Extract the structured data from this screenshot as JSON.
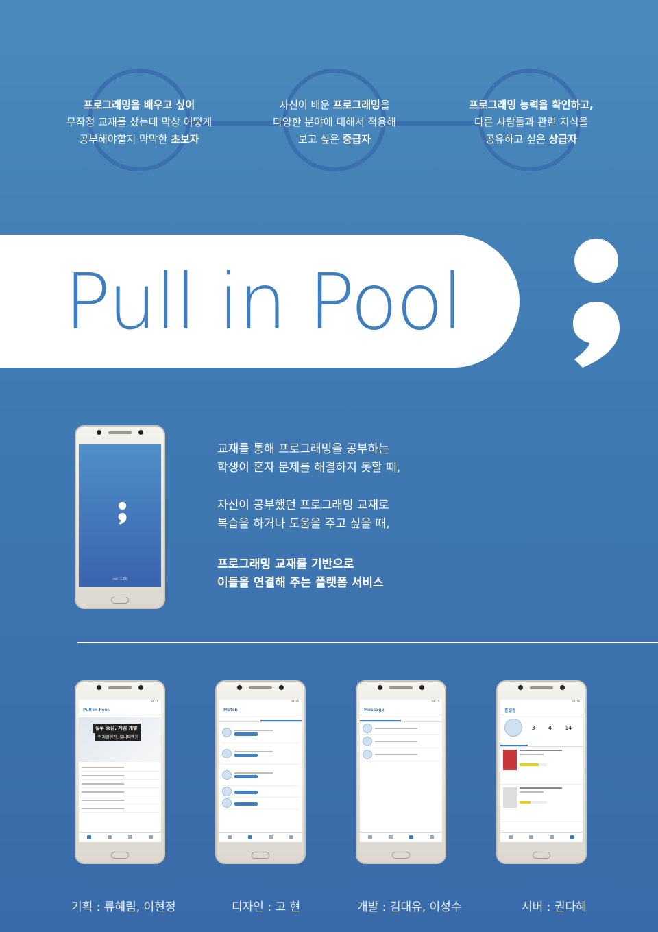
{
  "audiences": [
    {
      "lines": [
        "프로그래밍을 배우고 싶어",
        "무작정 교재를 샀는데 막상 어떻게",
        "공부해야할지 막막한 "
      ],
      "highlight": "초보자"
    },
    {
      "lines_a": [
        "자신이 배운 ",
        "다양한 분야에 대해서 적용해",
        "보고 싶은 "
      ],
      "bold_a": "프로그래밍",
      "suffix_a": "을",
      "highlight": "중급자"
    },
    {
      "lines": [
        "프로그래밍 능력을 확인하고,",
        "다른 사람들과 관련 지식을",
        "공유하고 싶은 "
      ],
      "highlight": "상급자"
    }
  ],
  "banner": {
    "title": "Pull in Pool"
  },
  "description": {
    "para1": [
      "교재를 통해 프로그래밍을 공부하는",
      "학생이 혼자 문제를 해결하지 못할 때,"
    ],
    "para2": [
      "자신이 공부했던 프로그래밍 교재로",
      "복습을 하거나 도움을 주고 싶을 때,"
    ],
    "para3": [
      "프로그래밍 교재를 기반으로",
      "이들을 연결해 주는 플랫폼 서비스"
    ]
  },
  "splash": {
    "version": "ver. 1.00"
  },
  "screens": {
    "home": {
      "title": "Pull in Pool",
      "banner_line1": "실무 중심, 게임 개발",
      "banner_line2": "언리얼엔진, 유니티엔진"
    },
    "match": {
      "title": "Match"
    },
    "message": {
      "title": "Message"
    },
    "profile": {
      "title": "홍길동",
      "stat1": "3",
      "stat2": "4",
      "stat3": "14"
    }
  },
  "credits": {
    "planning": "기획 : 류혜림, 이현정",
    "design": "디자인 : 고 현",
    "dev": "개발 : 김대유, 이성수",
    "server": "서버 : 권다혜"
  },
  "colors": {
    "accent": "#3f7fbf",
    "ring": "#3b6fb0",
    "background": "#4585ba"
  }
}
